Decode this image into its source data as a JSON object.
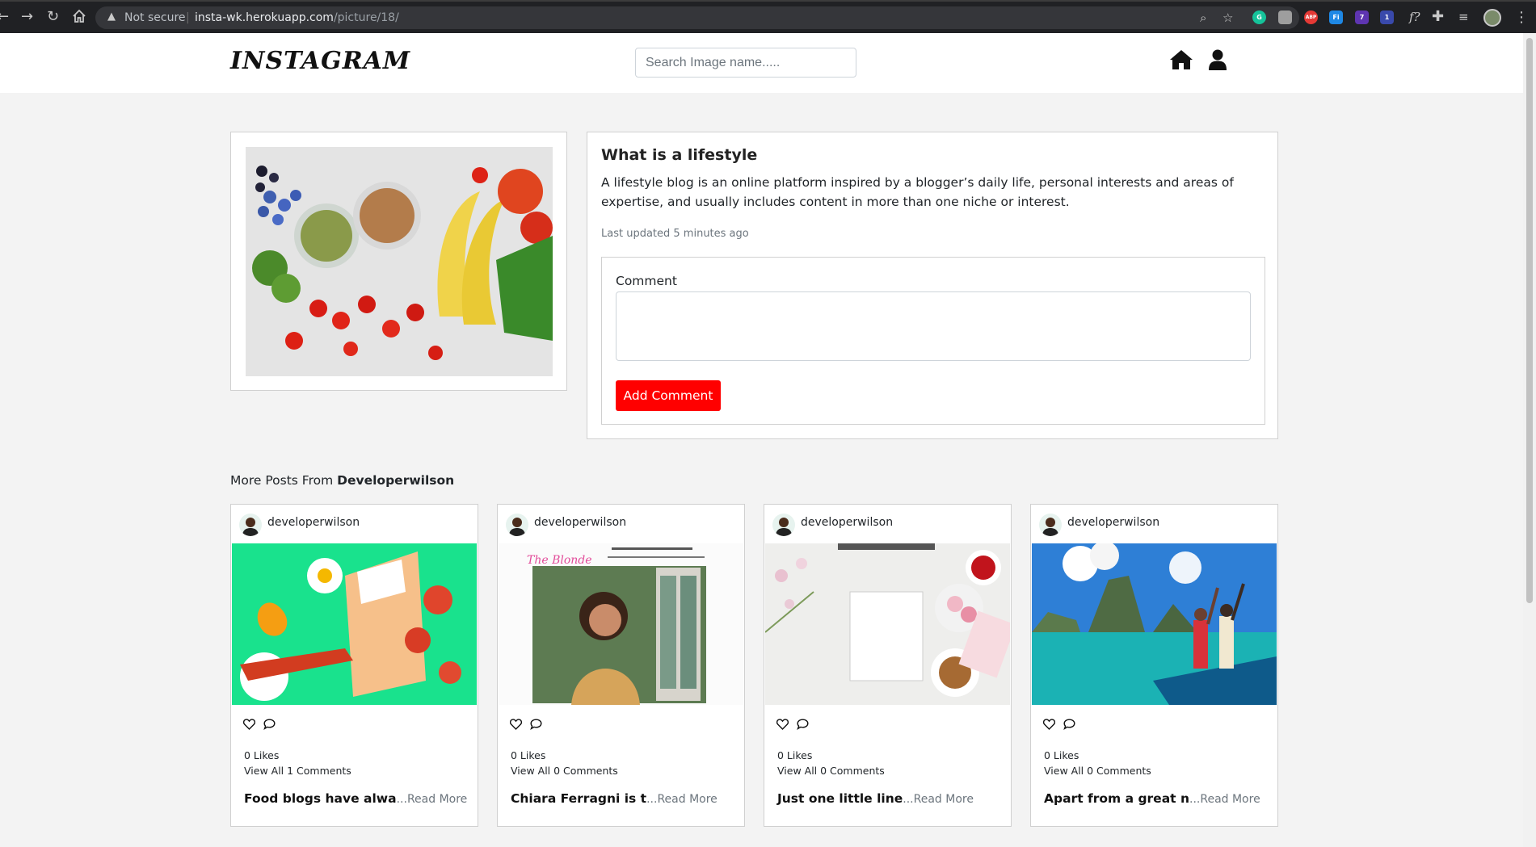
{
  "browser": {
    "security_label": "Not secure",
    "url_host": "insta-wk.herokuapp.com",
    "url_path": "/picture/18/",
    "extensions": [
      {
        "name": "grammarly-icon",
        "label": "G",
        "color": "#15c39a"
      },
      {
        "name": "extension-square-icon",
        "label": "",
        "color": "#9e9e9e"
      },
      {
        "name": "adblock-icon",
        "label": "ABP",
        "color": "#e53935"
      },
      {
        "name": "fi-extension-icon",
        "label": "Fi",
        "color": "#1e88e5"
      },
      {
        "name": "puzzle-badge-icon",
        "label": "7",
        "color": "#5e35b1"
      },
      {
        "name": "share-badge-icon",
        "label": "1",
        "color": "#3949ab"
      }
    ]
  },
  "header": {
    "logo": "INSTAGRAM",
    "search_placeholder": "Search Image name....."
  },
  "post": {
    "title": "What is a lifestyle",
    "description": "A lifestyle blog is an online platform inspired by a blogger’s daily life, personal interests and areas of expertise, and usually includes content in more than one niche or interest.",
    "last_updated": "Last updated 5 minutes ago",
    "comment_label": "Comment",
    "add_comment_label": "Add Comment"
  },
  "more_posts": {
    "prefix": "More Posts From ",
    "author": "Developerwilson",
    "items": [
      {
        "username": "developerwilson",
        "likes": "0 Likes",
        "comments": "View All 1 Comments",
        "caption": "Food blogs have alwa",
        "read_more": "...Read More"
      },
      {
        "username": "developerwilson",
        "likes": "0 Likes",
        "comments": "View All 0 Comments",
        "caption": "Chiara Ferragni is t",
        "read_more": "...Read More"
      },
      {
        "username": "developerwilson",
        "likes": "0 Likes",
        "comments": "View All 0 Comments",
        "caption": "Just one little line",
        "read_more": "...Read More"
      },
      {
        "username": "developerwilson",
        "likes": "0 Likes",
        "comments": "View All 0 Comments",
        "caption": "Apart from a great n",
        "read_more": "...Read More"
      }
    ]
  },
  "colors": {
    "accent_button": "#ff0000",
    "page_background": "#f3f3f3",
    "card_border": "#d0d0d0"
  }
}
